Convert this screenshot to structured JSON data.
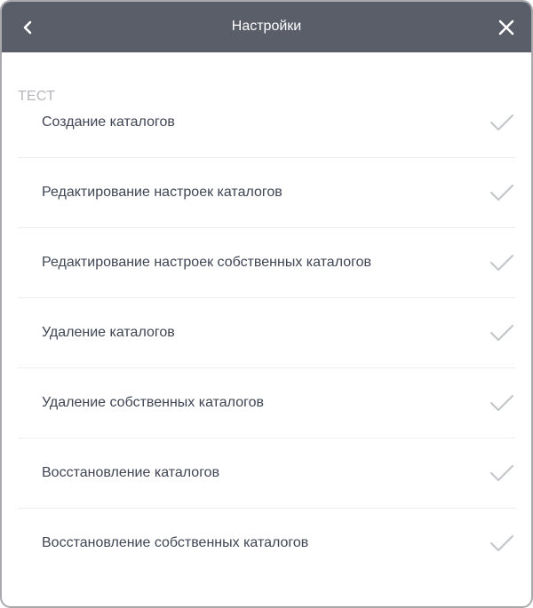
{
  "header": {
    "title": "Настройки",
    "back_icon": "chevron-left-icon",
    "close_icon": "close-icon",
    "background": "#5a5e69"
  },
  "section": {
    "title": "ТЕСТ",
    "items": [
      {
        "label": "Создание каталогов",
        "checked": true
      },
      {
        "label": "Редактирование настроек каталогов",
        "checked": true
      },
      {
        "label": "Редактирование настроек собственных каталогов",
        "checked": true
      },
      {
        "label": "Удаление каталогов",
        "checked": true
      },
      {
        "label": "Удаление собственных каталогов",
        "checked": true
      },
      {
        "label": "Восстановление каталогов",
        "checked": true
      },
      {
        "label": "Восстановление собственных каталогов",
        "checked": true
      }
    ]
  },
  "colors": {
    "check": "#c4c6ca",
    "text": "#3f4553",
    "section_title": "#b4b6bb"
  }
}
